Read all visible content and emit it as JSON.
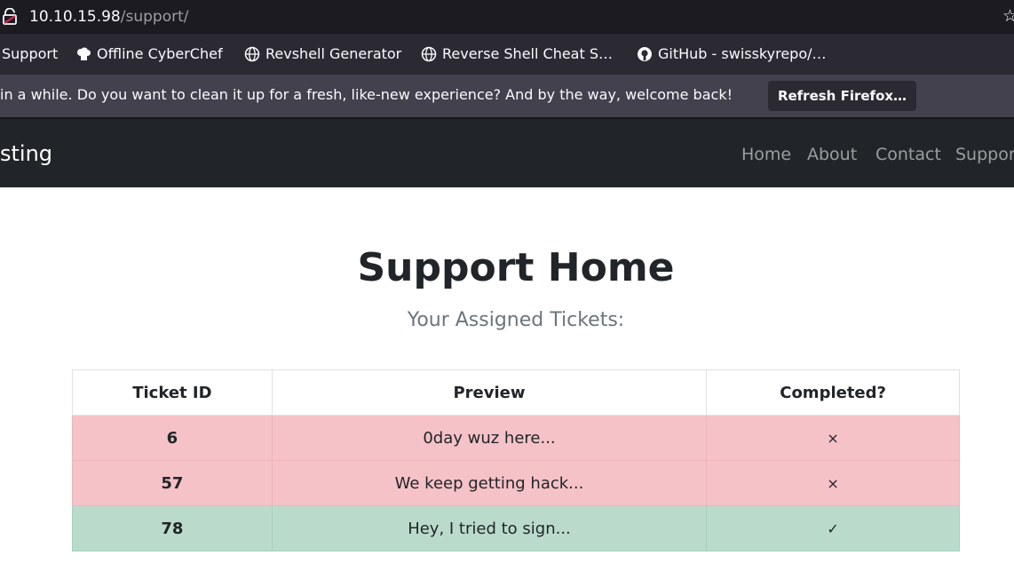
{
  "browser": {
    "url_host": "10.10.15.98",
    "url_path": "/support/",
    "bookmarks": [
      {
        "label": "Support",
        "icon": "none"
      },
      {
        "label": "Offline CyberChef",
        "icon": "chef-hat-icon"
      },
      {
        "label": "Revshell Generator",
        "icon": "globe-icon"
      },
      {
        "label": "Reverse Shell Cheat S…",
        "icon": "globe-icon"
      },
      {
        "label": "GitHub - swisskyrepo/…",
        "icon": "github-icon"
      }
    ],
    "notification": {
      "message": "in a while. Do you want to clean it up for a fresh, like-new experience? And by the way, welcome back!",
      "button": "Refresh Firefox…"
    }
  },
  "site": {
    "brand": "sting",
    "nav": [
      "Home",
      "About",
      "Contact",
      "Suppor"
    ]
  },
  "main": {
    "title": "Support Home",
    "subtitle": "Your Assigned Tickets:",
    "table": {
      "headers": [
        "Ticket ID",
        "Preview",
        "Completed?"
      ],
      "rows": [
        {
          "id": "6",
          "preview": "0day wuz here...",
          "completed": "×",
          "status": "incomplete"
        },
        {
          "id": "57",
          "preview": "We keep getting hack...",
          "completed": "×",
          "status": "incomplete"
        },
        {
          "id": "78",
          "preview": "Hey, I tried to sign...",
          "completed": "✓",
          "status": "complete"
        }
      ]
    }
  },
  "colors": {
    "incomplete_row": "#f5c2c7",
    "complete_row": "#badbcc",
    "navbar": "#212529"
  }
}
